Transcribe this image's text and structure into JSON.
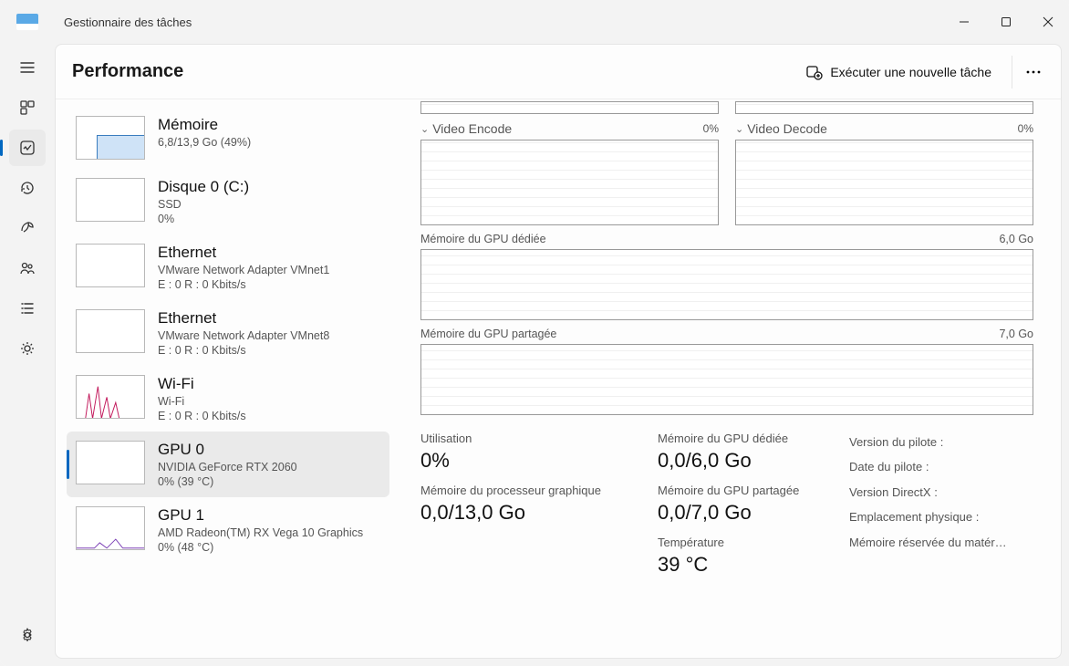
{
  "window": {
    "title": "Gestionnaire des tâches"
  },
  "header": {
    "page_title": "Performance",
    "run_task": "Exécuter une nouvelle tâche"
  },
  "sidebar": {
    "items": [
      {
        "title": "Mémoire",
        "sub1": "6,8/13,9 Go (49%)",
        "sub2": ""
      },
      {
        "title": "Disque 0 (C:)",
        "sub1": "SSD",
        "sub2": "0%"
      },
      {
        "title": "Ethernet",
        "sub1": "VMware Network Adapter VMnet1",
        "sub2": "E : 0 R : 0 Kbits/s"
      },
      {
        "title": "Ethernet",
        "sub1": "VMware Network Adapter VMnet8",
        "sub2": "E : 0 R : 0 Kbits/s"
      },
      {
        "title": "Wi-Fi",
        "sub1": "Wi-Fi",
        "sub2": "E : 0 R : 0 Kbits/s"
      },
      {
        "title": "GPU 0",
        "sub1": "NVIDIA GeForce RTX 2060",
        "sub2": "0%  (39 °C)"
      },
      {
        "title": "GPU 1",
        "sub1": "AMD Radeon(TM) RX Vega 10 Graphics",
        "sub2": "0%  (48 °C)"
      }
    ]
  },
  "detail": {
    "encode_label": "Video Encode",
    "encode_val": "0%",
    "decode_label": "Video Decode",
    "decode_val": "0%",
    "dedmem_label": "Mémoire du GPU dédiée",
    "dedmem_max": "6,0 Go",
    "shmem_label": "Mémoire du GPU partagée",
    "shmem_max": "7,0 Go",
    "stats": {
      "util_lbl": "Utilisation",
      "util_val": "0%",
      "gpumem_lbl": "Mémoire du processeur graphique",
      "gpumem_val": "0,0/13,0 Go",
      "ded_lbl": "Mémoire du GPU dédiée",
      "ded_val": "0,0/6,0 Go",
      "sh_lbl": "Mémoire du GPU partagée",
      "sh_val": "0,0/7,0 Go",
      "temp_lbl": "Température",
      "temp_val": "39 °C"
    },
    "info": {
      "driver_ver": "Version du pilote :",
      "driver_date": "Date du pilote :",
      "dx_ver": "Version DirectX :",
      "phys_loc": "Emplacement physique :",
      "reserved": "Mémoire réservée du matér…"
    }
  }
}
